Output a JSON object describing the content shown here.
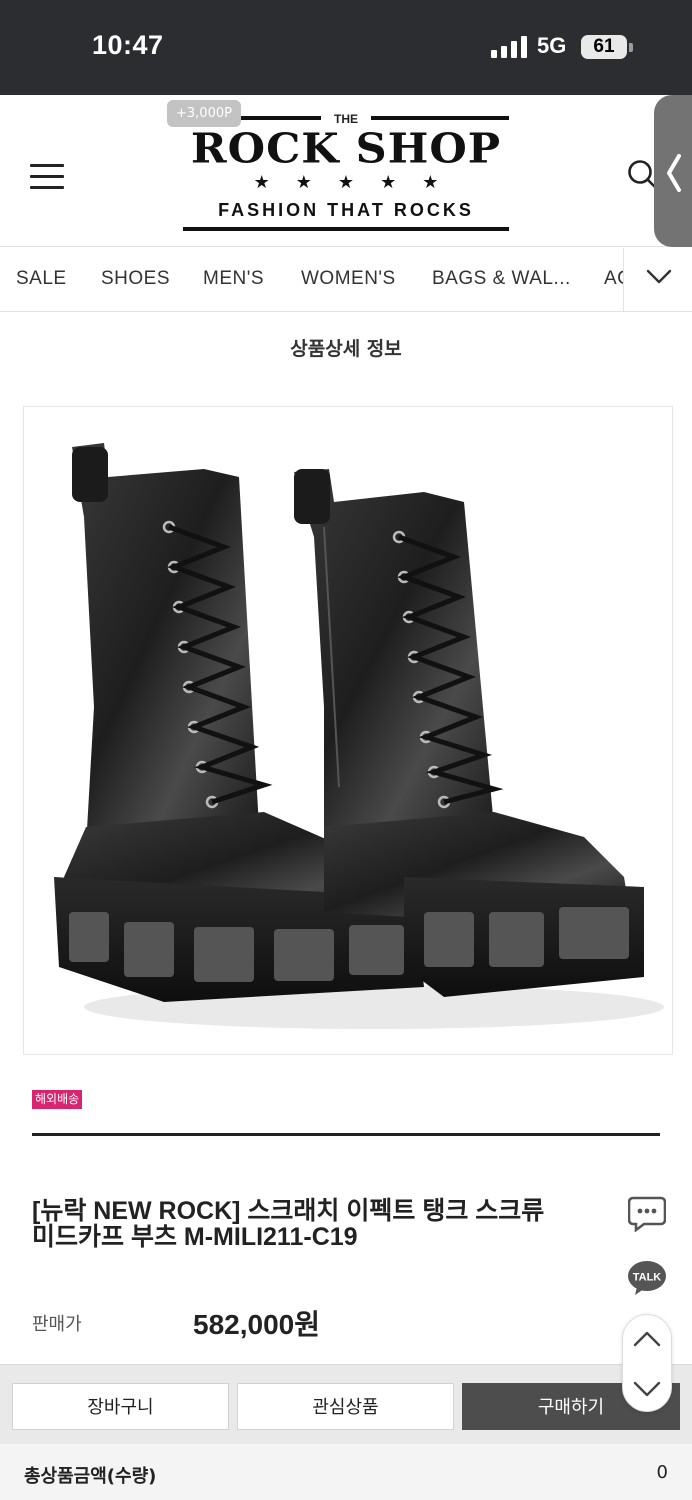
{
  "status_bar": {
    "time": "10:47",
    "network": "5G",
    "battery": "61"
  },
  "header": {
    "point_badge": "+3,000P",
    "logo": {
      "the": "THE",
      "name": "ROCK SHOP",
      "stars": "★★★★★",
      "tagline": "FASHION THAT ROCKS"
    },
    "icons": {
      "menu": "hamburger-menu-icon",
      "search": "search-icon",
      "side_tab": "chevron-left-icon"
    }
  },
  "category_nav": {
    "items": [
      "SALE",
      "SHOES",
      "MEN'S",
      "WOMEN'S",
      "BAGS & WAL...",
      "AC"
    ],
    "toggle_icon": "chevron-down-icon"
  },
  "page": {
    "section_title": "상품상세 정보"
  },
  "product": {
    "image_alt": "New Rock platform lace-up boots",
    "badge": "해외배송",
    "name_line1": "[뉴락 NEW ROCK] 스크래치 이펙트 탱크 스크류",
    "name_line2": "미드카프 부츠 M-MILI211-C19",
    "price_label": "판매가",
    "price_value": "582,000원",
    "colors": {
      "badge": "#d9246f",
      "buy_button": "#4d4d4d"
    }
  },
  "floating": {
    "chat_icon": "chat-bubble-icon",
    "talk_label": "TALK",
    "scroll_up_icon": "chevron-up-icon",
    "scroll_down_icon": "chevron-down-icon"
  },
  "actions": {
    "cart": "장바구니",
    "wishlist": "관심상품",
    "buy": "구매하기"
  },
  "total": {
    "label": "총상품금액(수량)",
    "value": "0"
  }
}
